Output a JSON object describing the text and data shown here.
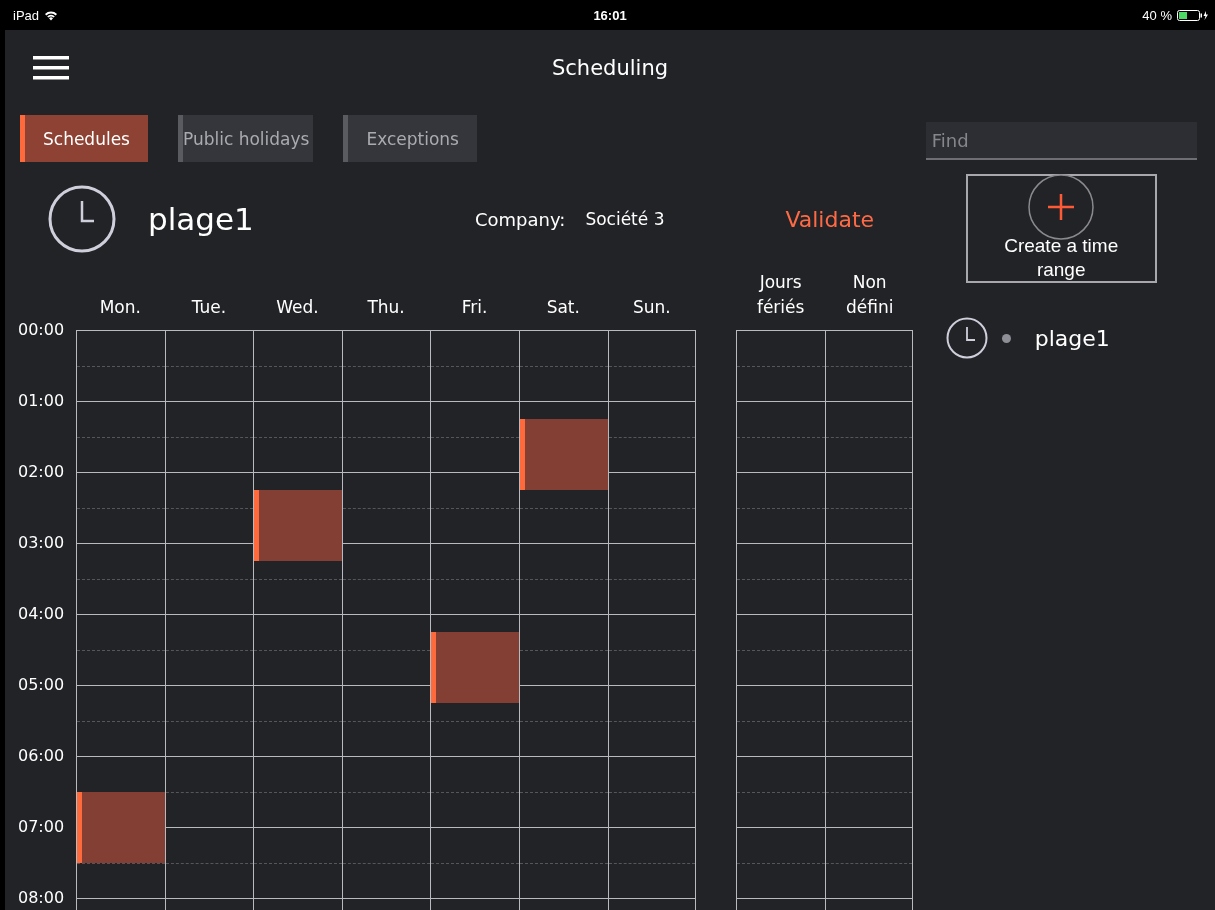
{
  "status_bar": {
    "device": "iPad",
    "time": "16:01",
    "battery": "40 %"
  },
  "header": {
    "title": "Scheduling"
  },
  "tabs": [
    {
      "label": "Schedules",
      "selected": true
    },
    {
      "label": "Public holidays",
      "selected": false
    },
    {
      "label": "Exceptions",
      "selected": false
    }
  ],
  "schedule": {
    "name": "plage1",
    "company_label": "Company:",
    "company": "Société 3",
    "validate": "Validate"
  },
  "hours": [
    "00:00",
    "01:00",
    "02:00",
    "03:00",
    "04:00",
    "05:00",
    "06:00",
    "07:00",
    "08:00"
  ],
  "days": [
    {
      "label": "Mon.",
      "quarters": [
        false,
        false,
        false,
        false,
        false,
        false,
        false,
        false,
        false,
        false,
        false,
        false,
        false,
        false,
        false,
        false,
        false,
        false,
        false,
        false,
        false,
        false,
        false,
        false,
        false,
        false,
        true,
        true,
        true,
        true,
        false,
        false
      ]
    },
    {
      "label": "Tue.",
      "quarters": [
        false,
        false,
        false,
        false,
        false,
        false,
        false,
        false,
        false,
        false,
        false,
        false,
        false,
        false,
        false,
        false,
        false,
        false,
        false,
        false,
        false,
        false,
        false,
        false,
        false,
        false,
        false,
        false,
        false,
        false,
        false,
        false
      ]
    },
    {
      "label": "Wed.",
      "quarters": [
        false,
        false,
        false,
        false,
        false,
        false,
        false,
        false,
        false,
        true,
        true,
        true,
        true,
        false,
        false,
        false,
        false,
        false,
        false,
        false,
        false,
        false,
        false,
        false,
        false,
        false,
        false,
        false,
        false,
        false,
        false,
        false
      ]
    },
    {
      "label": "Thu.",
      "quarters": [
        false,
        false,
        false,
        false,
        false,
        false,
        false,
        false,
        false,
        false,
        false,
        false,
        false,
        false,
        false,
        false,
        false,
        false,
        false,
        false,
        false,
        false,
        false,
        false,
        false,
        false,
        false,
        false,
        false,
        false,
        false,
        false
      ]
    },
    {
      "label": "Fri.",
      "quarters": [
        false,
        false,
        false,
        false,
        false,
        false,
        false,
        false,
        false,
        false,
        false,
        false,
        false,
        false,
        false,
        false,
        false,
        true,
        true,
        true,
        true,
        false,
        false,
        false,
        false,
        false,
        false,
        false,
        false,
        false,
        false,
        false
      ]
    },
    {
      "label": "Sat.",
      "quarters": [
        false,
        false,
        false,
        false,
        false,
        true,
        true,
        true,
        true,
        false,
        false,
        false,
        false,
        false,
        false,
        false,
        false,
        false,
        false,
        false,
        false,
        false,
        false,
        false,
        false,
        false,
        false,
        false,
        false,
        false,
        false,
        false
      ]
    },
    {
      "label": "Sun.",
      "quarters": [
        false,
        false,
        false,
        false,
        false,
        false,
        false,
        false,
        false,
        false,
        false,
        false,
        false,
        false,
        false,
        false,
        false,
        false,
        false,
        false,
        false,
        false,
        false,
        false,
        false,
        false,
        false,
        false,
        false,
        false,
        false,
        false
      ]
    }
  ],
  "extra_columns": [
    {
      "label": "Jours fériés"
    },
    {
      "label": "Non défini"
    }
  ],
  "sidebar": {
    "search": {
      "placeholder": "Find"
    },
    "create_button": "Create a time range",
    "items": [
      {
        "name": "plage1"
      }
    ]
  }
}
